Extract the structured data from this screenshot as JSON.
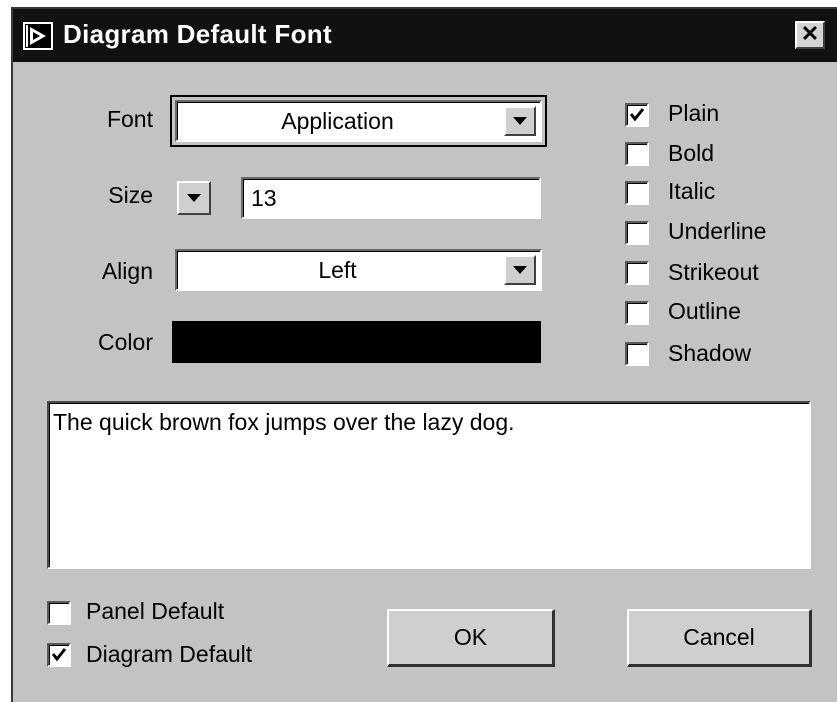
{
  "window": {
    "title": "Diagram Default Font",
    "close_label": "✕"
  },
  "font": {
    "label": "Font",
    "value": "Application"
  },
  "size": {
    "label": "Size",
    "value": "13"
  },
  "align": {
    "label": "Align",
    "value": "Left"
  },
  "color": {
    "label": "Color",
    "swatch": "#000000"
  },
  "styles": [
    {
      "label": "Plain",
      "checked": true
    },
    {
      "label": "Bold",
      "checked": false
    },
    {
      "label": "Italic",
      "checked": false
    },
    {
      "label": "Underline",
      "checked": false
    },
    {
      "label": "Strikeout",
      "checked": false
    },
    {
      "label": "Outline",
      "checked": false
    },
    {
      "label": "Shadow",
      "checked": false
    }
  ],
  "preview": {
    "text": "The quick brown fox jumps over the lazy dog."
  },
  "defaults": {
    "panel": {
      "label": "Panel Default",
      "checked": false
    },
    "diagram": {
      "label": "Diagram Default",
      "checked": true
    }
  },
  "buttons": {
    "ok": "OK",
    "cancel": "Cancel"
  }
}
